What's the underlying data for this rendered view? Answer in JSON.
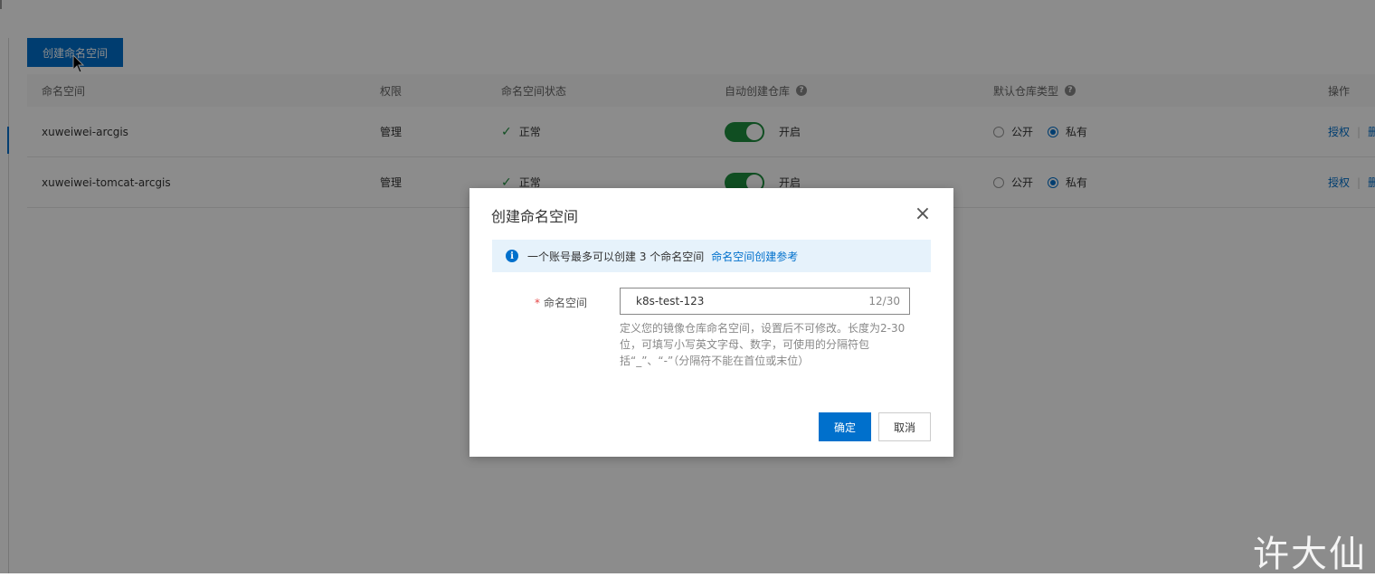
{
  "toolbar": {
    "create_label": "创建命名空间"
  },
  "table": {
    "headers": {
      "namespace": "命名空间",
      "permission": "权限",
      "status": "命名空间状态",
      "auto_create": "自动创建仓库",
      "default_type": "默认仓库类型",
      "actions": "操作"
    },
    "help_glyph": "?",
    "rows": [
      {
        "name": "xuweiwei-arcgis",
        "permission": "管理",
        "status": "正常",
        "auto_create": "开启",
        "public_label": "公开",
        "private_label": "私有",
        "selected": "private",
        "action_authorize": "授权",
        "action_delete": "删"
      },
      {
        "name": "xuweiwei-tomcat-arcgis",
        "permission": "管理",
        "status": "正常",
        "auto_create": "开启",
        "public_label": "公开",
        "private_label": "私有",
        "selected": "private",
        "action_authorize": "授权",
        "action_delete": "删"
      }
    ]
  },
  "dialog": {
    "title": "创建命名空间",
    "info_text": "一个账号最多可以创建 3 个命名空间",
    "info_link": "命名空间创建参考",
    "field_label": "命名空间",
    "field_required": "*",
    "field_value": "k8s-test-123",
    "field_count": "12/30",
    "hint": "定义您的镜像仓库命名空间，设置后不可修改。长度为2-30位，可填写小写英文字母、数字，可使用的分隔符包括“_”、“-”（分隔符不能在首位或末位）",
    "ok_label": "确定",
    "cancel_label": "取消"
  },
  "watermark": "许大仙",
  "colors": {
    "accent": "#0070cc",
    "success": "#1e8e3e",
    "info_bg": "#e6f2fb"
  },
  "icons": {
    "check": "check-icon",
    "close": "close-icon",
    "info": "info-icon",
    "help": "help-icon"
  }
}
